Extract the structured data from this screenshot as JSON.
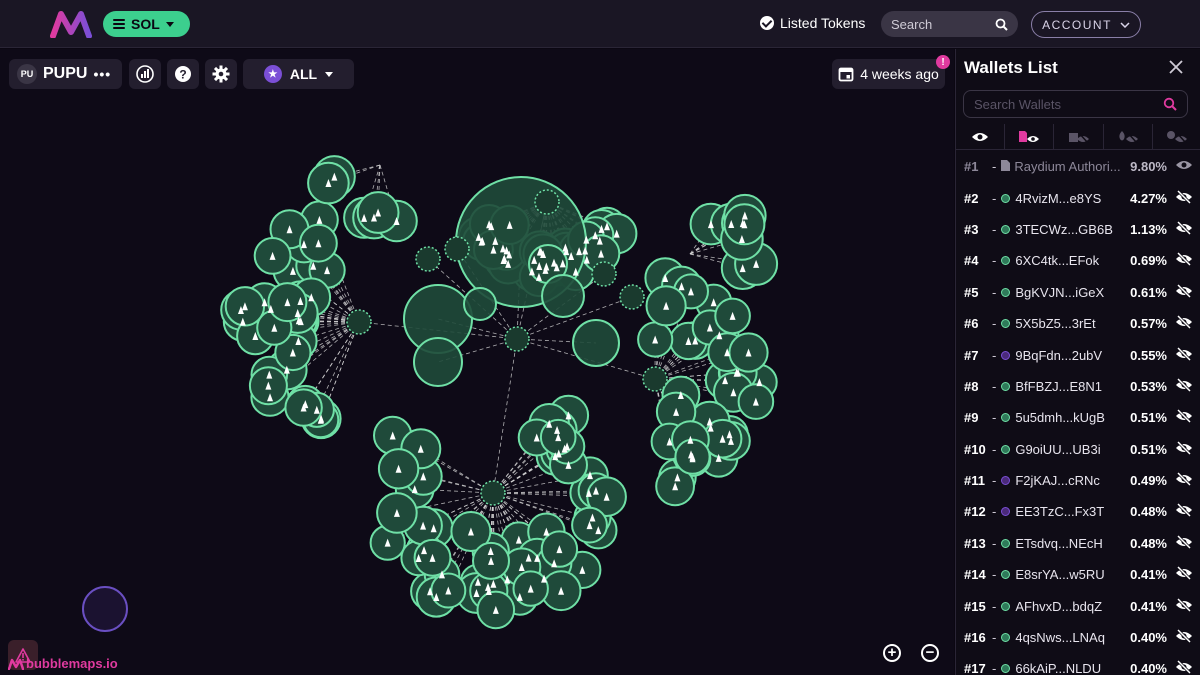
{
  "header": {
    "chain_label": "SOL",
    "listed_tokens_label": "Listed Tokens",
    "search_placeholder": "Search",
    "account_label": "ACCOUNT"
  },
  "toolbar": {
    "token_badge": "PU",
    "token_name": "PUPU",
    "more_label": "•••",
    "filter_label": "ALL",
    "date_label": "4 weeks ago",
    "notification_badge": "!"
  },
  "brand": {
    "name": "bubblemaps.io"
  },
  "colors": {
    "accent_green": "#3ccf8e",
    "bubble_fill": "#1f4a3a",
    "bubble_stroke": "#6fe0a6",
    "brand_pink": "#e03a9f",
    "purple": "#7b4fd6"
  },
  "sidebar": {
    "title": "Wallets List",
    "search_placeholder": "Search Wallets",
    "wallets": [
      {
        "rank": "#1",
        "address": "Raydium Authori...",
        "percent": "9.80%",
        "type": "contract",
        "visible": true
      },
      {
        "rank": "#2",
        "address": "4RvizM...e8YS",
        "percent": "4.27%",
        "type": "green",
        "visible": false
      },
      {
        "rank": "#3",
        "address": "3TECWz...GB6B",
        "percent": "1.13%",
        "type": "green",
        "visible": false
      },
      {
        "rank": "#4",
        "address": "6XC4tk...EFok",
        "percent": "0.69%",
        "type": "green",
        "visible": false
      },
      {
        "rank": "#5",
        "address": "BgKVJN...iGeX",
        "percent": "0.61%",
        "type": "green",
        "visible": false
      },
      {
        "rank": "#6",
        "address": "5X5bZ5...3rEt",
        "percent": "0.57%",
        "type": "green",
        "visible": false
      },
      {
        "rank": "#7",
        "address": "9BqFdn...2ubV",
        "percent": "0.55%",
        "type": "purple",
        "visible": false
      },
      {
        "rank": "#8",
        "address": "BfFBZJ...E8N1",
        "percent": "0.53%",
        "type": "green",
        "visible": false
      },
      {
        "rank": "#9",
        "address": "5u5dmh...kUgB",
        "percent": "0.51%",
        "type": "green",
        "visible": false
      },
      {
        "rank": "#10",
        "address": "G9oiUU...UB3i",
        "percent": "0.51%",
        "type": "green",
        "visible": false
      },
      {
        "rank": "#11",
        "address": "F2jKAJ...cRNc",
        "percent": "0.49%",
        "type": "purple",
        "visible": false
      },
      {
        "rank": "#12",
        "address": "EE3TzC...Fx3T",
        "percent": "0.48%",
        "type": "purple",
        "visible": false
      },
      {
        "rank": "#13",
        "address": "ETsdvq...NEcH",
        "percent": "0.48%",
        "type": "green",
        "visible": false
      },
      {
        "rank": "#14",
        "address": "E8srYA...w5RU",
        "percent": "0.41%",
        "type": "green",
        "visible": false
      },
      {
        "rank": "#15",
        "address": "AFhvxD...bdqZ",
        "percent": "0.41%",
        "type": "green",
        "visible": false
      },
      {
        "rank": "#16",
        "address": "4qsNws...LNAq",
        "percent": "0.40%",
        "type": "green",
        "visible": false
      },
      {
        "rank": "#17",
        "address": "66kAiP...NLDU",
        "percent": "0.40%",
        "type": "green",
        "visible": false
      }
    ]
  }
}
